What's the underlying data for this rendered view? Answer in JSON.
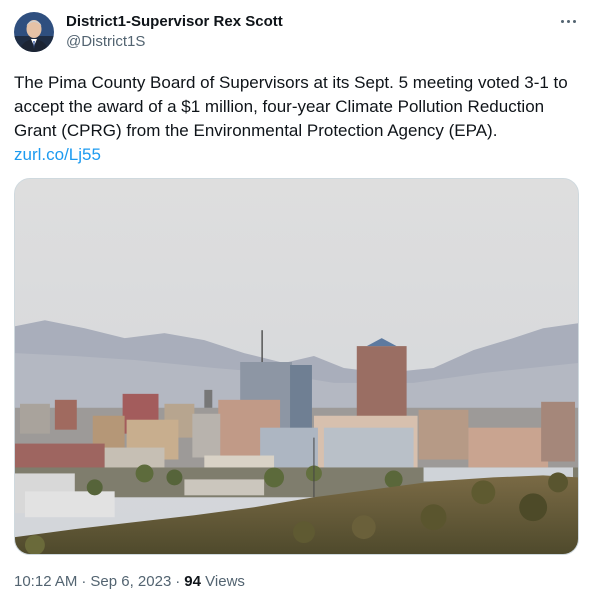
{
  "author": {
    "name": "District1-Supervisor Rex Scott",
    "handle": "@District1S",
    "avatar_icon": "profile-photo"
  },
  "tweet": {
    "text_lines": [
      "The Pima County Board of Supervisors at its Sept. 5 meeting voted 3-1 to",
      "accept the award of a $1 million, four-year Climate Pollution Reduction",
      "Grant (CPRG) from the Environmental Protection Agency (EPA)."
    ],
    "link": "zurl.co/Lj55",
    "media_icon": "city-skyline-photo"
  },
  "meta": {
    "time": "10:12 AM",
    "separator": "·",
    "date": "Sep 6, 2023",
    "views_count": "94",
    "views_label": "Views"
  },
  "menu": {
    "more_icon": "more-horizontal-icon"
  },
  "colors": {
    "text": "#0f1419",
    "secondary": "#536471",
    "link": "#1d9bf0",
    "border": "#cfd9de"
  }
}
